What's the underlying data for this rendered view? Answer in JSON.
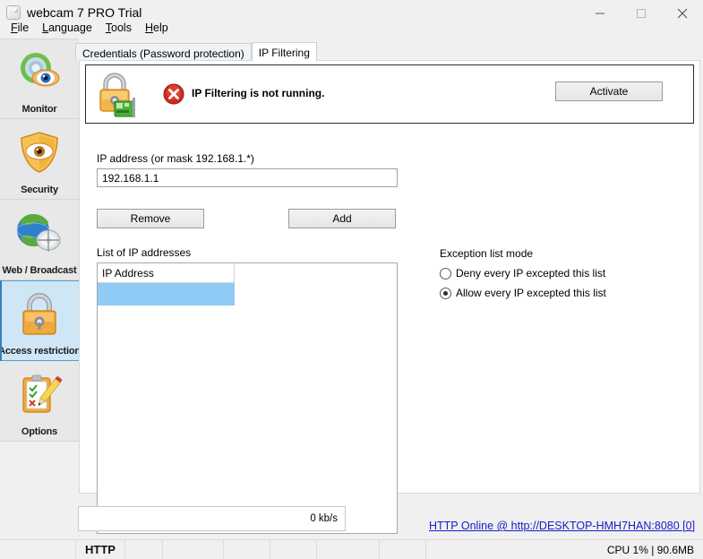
{
  "window": {
    "title": "webcam 7 PRO Trial",
    "icon": "app-window-icon",
    "minimize": "minimize-icon",
    "maximize": "maximize-icon",
    "close": "close-icon"
  },
  "menu": [
    {
      "label": "File",
      "accel": "F"
    },
    {
      "label": "Language",
      "accel": "L"
    },
    {
      "label": "Tools",
      "accel": "T"
    },
    {
      "label": "Help",
      "accel": "H"
    }
  ],
  "sidebar": {
    "items": [
      {
        "label": "Monitor",
        "icon": "monitor-eye-icon",
        "selected": false
      },
      {
        "label": "Security",
        "icon": "shield-eye-icon",
        "selected": false
      },
      {
        "label": "Web / Broadcast",
        "icon": "globe-satellite-icon",
        "selected": false
      },
      {
        "label": "Access restriction",
        "icon": "padlock-icon",
        "selected": true
      },
      {
        "label": "Options",
        "icon": "clipboard-pencil-icon",
        "selected": false
      }
    ]
  },
  "tabs": [
    {
      "label": "Credentials (Password protection)",
      "active": false
    },
    {
      "label": "IP Filtering",
      "active": true
    }
  ],
  "banner": {
    "lock_icon": "padlock-network-icon",
    "error_icon": "error-circle-icon",
    "status_text": "IP Filtering is not running.",
    "activate_label": "Activate",
    "error_color": "#d02b1e"
  },
  "form": {
    "ip_label": "IP address (or mask 192.168.1.*)",
    "ip_value": "192.168.1.1",
    "ip_placeholder": "192.168.1.1",
    "remove_label": "Remove",
    "add_label": "Add"
  },
  "list": {
    "label": "List of  IP addresses",
    "column_header": "IP Address",
    "rows": [
      {
        "ip": "",
        "selected": true
      }
    ],
    "selection_color": "#8fcbf5"
  },
  "exception": {
    "title": "Exception list mode",
    "options": [
      {
        "label": "Deny every IP excepted this list",
        "selected": false
      },
      {
        "label": "Allow every IP excepted this list",
        "selected": true
      }
    ]
  },
  "bottom": {
    "rate": "0 kb/s",
    "http_link": "HTTP Online @ http://DESKTOP-HMH7HAN:8080 [0]",
    "link_color": "#1b1bc8"
  },
  "statusbar": {
    "cells": [
      "",
      "HTTP",
      "",
      "",
      "",
      "",
      "",
      ""
    ],
    "cpu": "CPU 1% | 90.6MB"
  }
}
